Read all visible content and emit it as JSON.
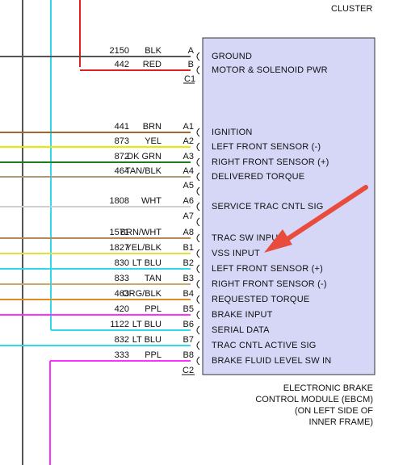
{
  "header": {
    "cluster_label": "CLUSTER"
  },
  "colors": {
    "module_fill": "#d6d6f7",
    "module_stroke": "#333333",
    "arrow": "#e74c3c",
    "BLK": "#555555",
    "RED": "#e02020",
    "BRN": "#a0682a",
    "YEL": "#e8e800",
    "DK GRN": "#1f7a1f",
    "TAN/BLK": "#a89b7a",
    "WHT": "#d0d0d0",
    "BRN/WHT": "#b78a55",
    "YEL/BLK": "#e0e040",
    "LT BLU": "#30d8e8",
    "TAN": "#c8a870",
    "ORG/BLK": "#e08a20",
    "PPL": "#ff30ff"
  },
  "pins": [
    {
      "circuit": "2150",
      "color": "BLK",
      "pin": "A",
      "label": "GROUND"
    },
    {
      "circuit": "442",
      "color": "RED",
      "pin": "B",
      "label": "MOTOR & SOLENOID PWR"
    },
    {
      "circuit": "441",
      "color": "BRN",
      "pin": "A1",
      "label": "IGNITION"
    },
    {
      "circuit": "873",
      "color": "YEL",
      "pin": "A2",
      "label": "LEFT FRONT SENSOR (-)"
    },
    {
      "circuit": "872",
      "color": "DK GRN",
      "pin": "A3",
      "label": "RIGHT FRONT SENSOR (+)"
    },
    {
      "circuit": "464",
      "color": "TAN/BLK",
      "pin": "A4",
      "label": "DELIVERED TORQUE"
    },
    {
      "circuit": "",
      "color": "",
      "pin": "A5",
      "label": ""
    },
    {
      "circuit": "1808",
      "color": "WHT",
      "pin": "A6",
      "label": "SERVICE TRAC CNTL SIG"
    },
    {
      "circuit": "",
      "color": "",
      "pin": "A7",
      "label": ""
    },
    {
      "circuit": "1571",
      "color": "BRN/WHT",
      "pin": "A8",
      "label": "TRAC SW INPUT"
    },
    {
      "circuit": "1827",
      "color": "YEL/BLK",
      "pin": "B1",
      "label": "VSS INPUT"
    },
    {
      "circuit": "830",
      "color": "LT BLU",
      "pin": "B2",
      "label": "LEFT FRONT SENSOR (+)"
    },
    {
      "circuit": "833",
      "color": "TAN",
      "pin": "B3",
      "label": "RIGHT FRONT SENSOR (-)"
    },
    {
      "circuit": "463",
      "color": "ORG/BLK",
      "pin": "B4",
      "label": "REQUESTED TORQUE"
    },
    {
      "circuit": "420",
      "color": "PPL",
      "pin": "B5",
      "label": "BRAKE INPUT"
    },
    {
      "circuit": "1122",
      "color": "LT BLU",
      "pin": "B6",
      "label": "SERIAL DATA"
    },
    {
      "circuit": "832",
      "color": "LT BLU",
      "pin": "B7",
      "label": "TRAC CNTL ACTIVE SIG"
    },
    {
      "circuit": "333",
      "color": "PPL",
      "pin": "B8",
      "label": "BRAKE FLUID LEVEL SW IN"
    }
  ],
  "connectors": [
    "C1",
    "C2"
  ],
  "module_caption": [
    "ELECTRONIC BRAKE",
    "CONTROL MODULE (EBCM)",
    "(ON LEFT SIDE OF",
    "INNER FRAME)"
  ]
}
